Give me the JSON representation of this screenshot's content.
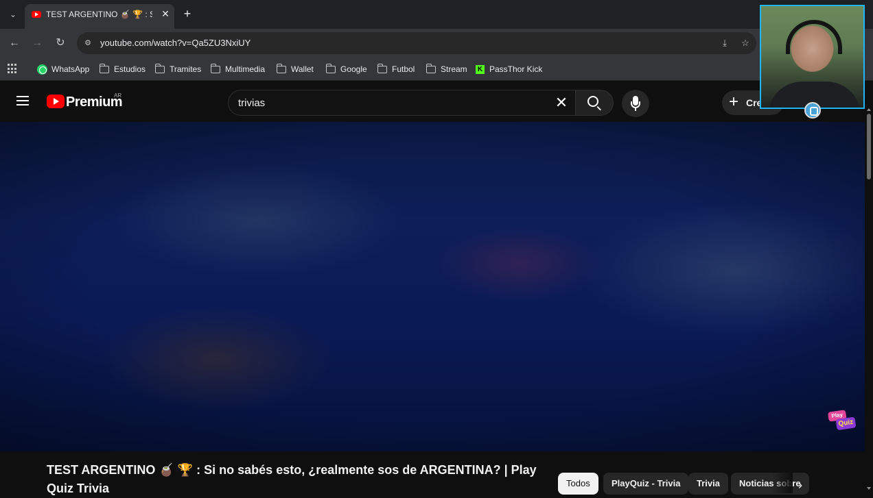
{
  "browser": {
    "tab_title": "TEST ARGENTINO 🧉 🏆 : Si no sabés esto",
    "tab_close": "✕",
    "new_tab": "+",
    "url": "youtube.com/watch?v=Qa5ZU3NxiUY",
    "back": "←",
    "forward": "→",
    "reload": "↻",
    "menu": "⌄",
    "install_icon": "⤓",
    "star_icon": "☆"
  },
  "bookmarks": [
    {
      "label": "WhatsApp",
      "icon": "whatsapp-icon"
    },
    {
      "label": "Estudios",
      "icon": "folder-icon"
    },
    {
      "label": "Tramites",
      "icon": "folder-icon"
    },
    {
      "label": "Multimedia",
      "icon": "folder-icon"
    },
    {
      "label": "Wallet",
      "icon": "folder-icon"
    },
    {
      "label": "Google",
      "icon": "folder-icon"
    },
    {
      "label": "Futbol",
      "icon": "folder-icon"
    },
    {
      "label": "Stream",
      "icon": "folder-icon"
    },
    {
      "label": "PassThor Kick",
      "icon": "kick-icon"
    }
  ],
  "youtube": {
    "logo_text": "Premium",
    "country": "AR",
    "search_value": "trivias",
    "search_clear": "✕",
    "create_label": "Crear"
  },
  "video": {
    "title": "TEST ARGENTINO 🧉 🏆 : Si no sabés esto, ¿realmente sos de ARGENTINA? | Play Quiz Trivia",
    "watermark_top": "Play",
    "watermark_bottom": "Quiz"
  },
  "chips": [
    {
      "label": "Todos",
      "active": true
    },
    {
      "label": "PlayQuiz - Trivia",
      "active": false
    },
    {
      "label": "Trivia",
      "active": false
    },
    {
      "label": "Noticias sobre",
      "active": false
    }
  ],
  "chips_next": "›",
  "colors": {
    "brand": "#ff0000",
    "webcam_border": "#1fb6ff",
    "player_bg": "#0d1e58"
  }
}
